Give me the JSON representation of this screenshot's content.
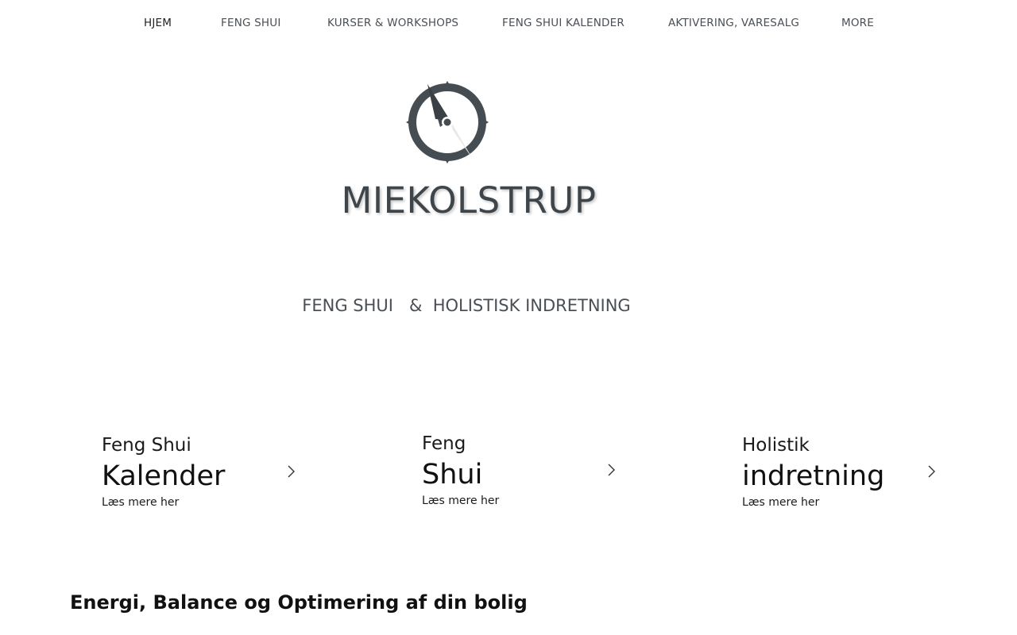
{
  "nav": {
    "items": [
      {
        "label": "HJEM"
      },
      {
        "label": "FENG SHUI"
      },
      {
        "label": "KURSER & WORKSHOPS"
      },
      {
        "label": "FENG SHUI KALENDER"
      },
      {
        "label": "AKTIVERING, VARESALG"
      },
      {
        "label": "MORE"
      }
    ]
  },
  "logo": {
    "text": "MIEKOLSTRUP",
    "icon": "compass-icon"
  },
  "tagline": "FENG SHUI   &  HOLISTISK INDRETNING",
  "cards": [
    {
      "small": "Feng Shui",
      "big": "Kalender",
      "link": "Læs mere her"
    },
    {
      "small": "Feng",
      "big": "Shui",
      "link": "Læs mere her"
    },
    {
      "small": "Holistik",
      "big": "indretning",
      "link": "Læs mere her"
    }
  ],
  "section": {
    "heading": "Energi, Balance og Optimering af din bolig"
  },
  "colors": {
    "text": "#4a4f55",
    "logo": "#3e464c",
    "background": "#ffffff"
  }
}
